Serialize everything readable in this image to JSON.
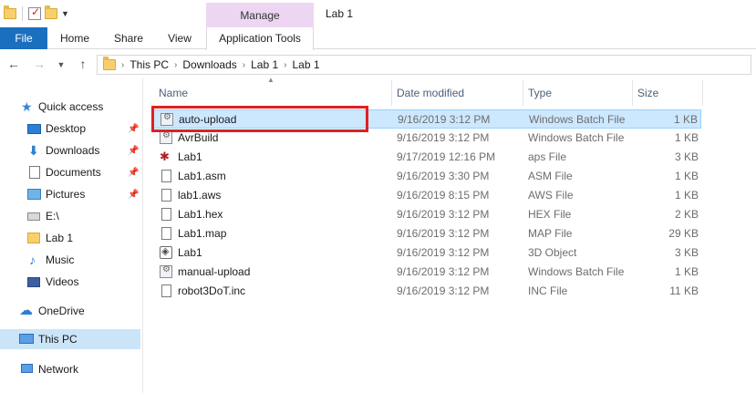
{
  "window": {
    "title": "Lab 1",
    "context_tab_header": "Manage"
  },
  "ribbon": {
    "tabs": [
      {
        "label": "File"
      },
      {
        "label": "Home"
      },
      {
        "label": "Share"
      },
      {
        "label": "View"
      },
      {
        "label": "Application Tools"
      }
    ]
  },
  "address": {
    "crumbs": [
      "This PC",
      "Downloads",
      "Lab 1",
      "Lab 1"
    ]
  },
  "nav": {
    "quick_access": "Quick access",
    "items": [
      {
        "label": "Desktop",
        "pinned": true
      },
      {
        "label": "Downloads",
        "pinned": true
      },
      {
        "label": "Documents",
        "pinned": true
      },
      {
        "label": "Pictures",
        "pinned": true
      },
      {
        "label": "E:\\",
        "pinned": false
      },
      {
        "label": "Lab 1",
        "pinned": false
      },
      {
        "label": "Music",
        "pinned": false
      },
      {
        "label": "Videos",
        "pinned": false
      }
    ],
    "onedrive": "OneDrive",
    "this_pc": "This PC",
    "network": "Network"
  },
  "columns": {
    "name": "Name",
    "date": "Date modified",
    "type": "Type",
    "size": "Size"
  },
  "files": [
    {
      "name": "auto-upload",
      "date": "9/16/2019 3:12 PM",
      "type": "Windows Batch File",
      "size": "1 KB",
      "icon": "batch-file-icon"
    },
    {
      "name": "AvrBuild",
      "date": "9/16/2019 3:12 PM",
      "type": "Windows Batch File",
      "size": "1 KB",
      "icon": "batch-file-icon"
    },
    {
      "name": "Lab1",
      "date": "9/17/2019 12:16 PM",
      "type": "aps File",
      "size": "3 KB",
      "icon": "aps-file-icon"
    },
    {
      "name": "Lab1.asm",
      "date": "9/16/2019 3:30 PM",
      "type": "ASM File",
      "size": "1 KB",
      "icon": "text-file-icon"
    },
    {
      "name": "lab1.aws",
      "date": "9/16/2019 8:15 PM",
      "type": "AWS File",
      "size": "1 KB",
      "icon": "text-file-icon"
    },
    {
      "name": "Lab1.hex",
      "date": "9/16/2019 3:12 PM",
      "type": "HEX File",
      "size": "2 KB",
      "icon": "text-file-icon"
    },
    {
      "name": "Lab1.map",
      "date": "9/16/2019 3:12 PM",
      "type": "MAP File",
      "size": "29 KB",
      "icon": "text-file-icon"
    },
    {
      "name": "Lab1",
      "date": "9/16/2019 3:12 PM",
      "type": "3D Object",
      "size": "3 KB",
      "icon": "3d-object-icon"
    },
    {
      "name": "manual-upload",
      "date": "9/16/2019 3:12 PM",
      "type": "Windows Batch File",
      "size": "1 KB",
      "icon": "batch-file-icon"
    },
    {
      "name": "robot3DoT.inc",
      "date": "9/16/2019 3:12 PM",
      "type": "INC File",
      "size": "11 KB",
      "icon": "text-file-icon"
    }
  ],
  "colors": {
    "file_tab": "#1a6fbf",
    "selection": "#cce8ff",
    "highlight": "#e02020",
    "manage": "#ecd6f2"
  }
}
